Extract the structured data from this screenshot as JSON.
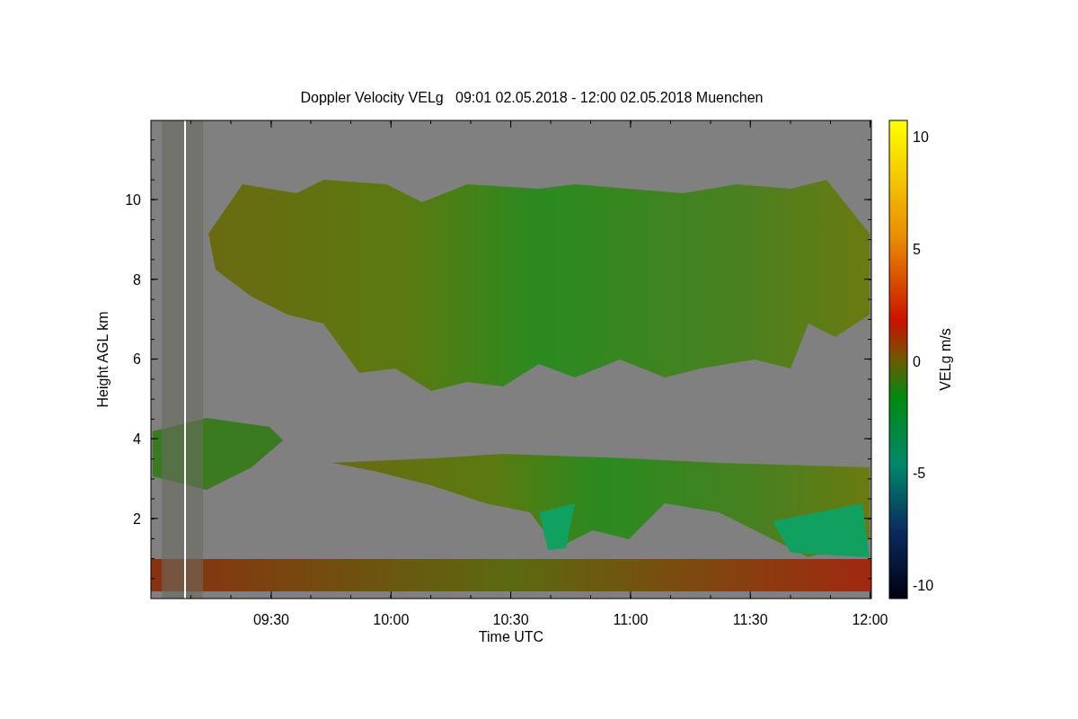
{
  "title": "Doppler Velocity VELg   09:01 02.05.2018 - 12:00 02.05.2018 Muenchen",
  "x_axis": {
    "label": "Time UTC",
    "ticks": [
      "09:30",
      "10:00",
      "10:30",
      "11:00",
      "11:30",
      "12:00"
    ]
  },
  "y_axis": {
    "label": "Height AGL km",
    "ticks": [
      "10",
      "8",
      "6",
      "4",
      "2"
    ]
  },
  "colorbar": {
    "label": "VELg m/s",
    "ticks": [
      "10",
      "5",
      "0",
      "-5",
      "-10"
    ]
  }
}
